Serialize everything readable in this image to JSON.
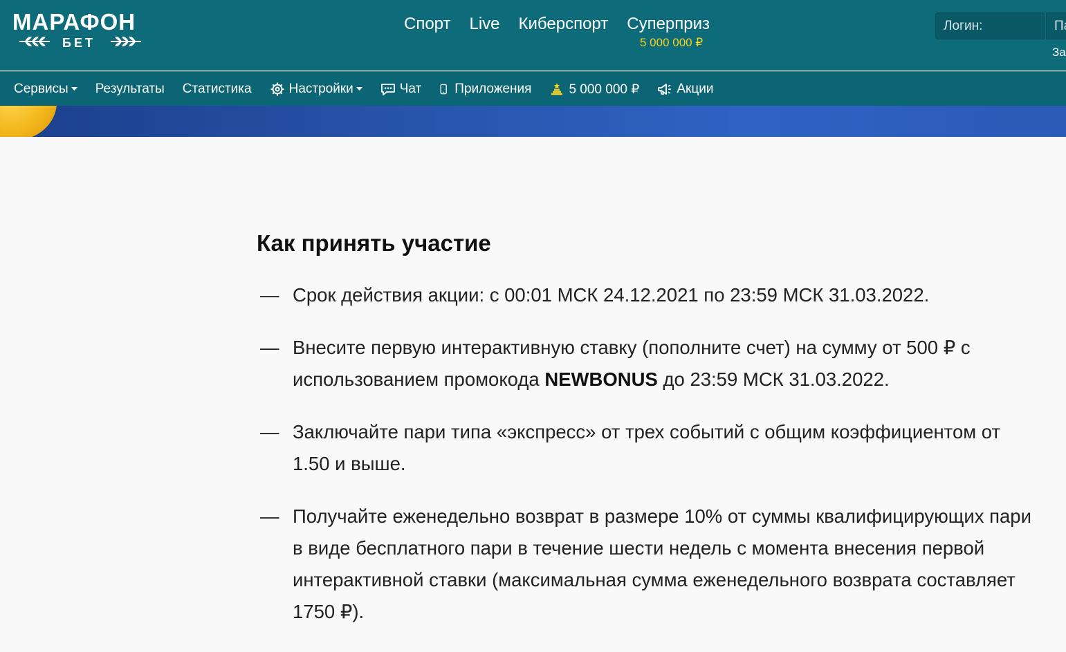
{
  "brand": {
    "name": "МАРАФОН",
    "sub": "БЕТ"
  },
  "main_nav": [
    {
      "label": "Спорт"
    },
    {
      "label": "Live"
    },
    {
      "label": "Киберспорт"
    },
    {
      "label": "Суперприз"
    }
  ],
  "superprize_amount": "5 000 000 ₽",
  "login": {
    "login_placeholder": "Логин:",
    "password_placeholder": "Па",
    "forgot_link": "За"
  },
  "sub_nav": [
    {
      "label": "Сервисы",
      "icon": "",
      "dropdown": true
    },
    {
      "label": "Результаты",
      "icon": "",
      "dropdown": false
    },
    {
      "label": "Статистика",
      "icon": "",
      "dropdown": false
    },
    {
      "label": "Настройки",
      "icon": "gear-icon",
      "dropdown": true
    },
    {
      "label": "Чат",
      "icon": "chat-icon",
      "dropdown": false
    },
    {
      "label": "Приложения",
      "icon": "phone-icon",
      "dropdown": false
    },
    {
      "label": "5 000 000 ₽",
      "icon": "prize-icon",
      "dropdown": false
    },
    {
      "label": "Акции",
      "icon": "megaphone-icon",
      "dropdown": false
    }
  ],
  "colors": {
    "header_bg": "#0d6b7a",
    "subnav_bg": "#0b6574",
    "prize_yellow": "#f5d31c",
    "banner_blue": "#2e63c4",
    "page_bg": "#f9f9f9"
  },
  "content": {
    "title": "Как принять участие",
    "dash": "—",
    "rules": [
      {
        "text": "Срок действия акции: с 00:01 МСК 24.12.2021 по 23:59 МСК 31.03.2022."
      },
      {
        "before": "Внесите первую интерактивную ставку (пополните счет) на сумму от 500 ₽ с использованием промокода ",
        "code": "NEWBONUS",
        "after": " до 23:59 МСК 31.03.2022."
      },
      {
        "text": "Заключайте пари типа «экспресс» от трех событий с общим коэффициентом от 1.50 и выше."
      },
      {
        "text": "Получайте еженедельно возврат в размере 10% от суммы квалифицирующих пари в виде бесплатного пари в течение шести недель с момента внесения первой интерактивной ставки (максимальная сумма еженедельного возврата составляет 1750 ₽)."
      }
    ]
  }
}
